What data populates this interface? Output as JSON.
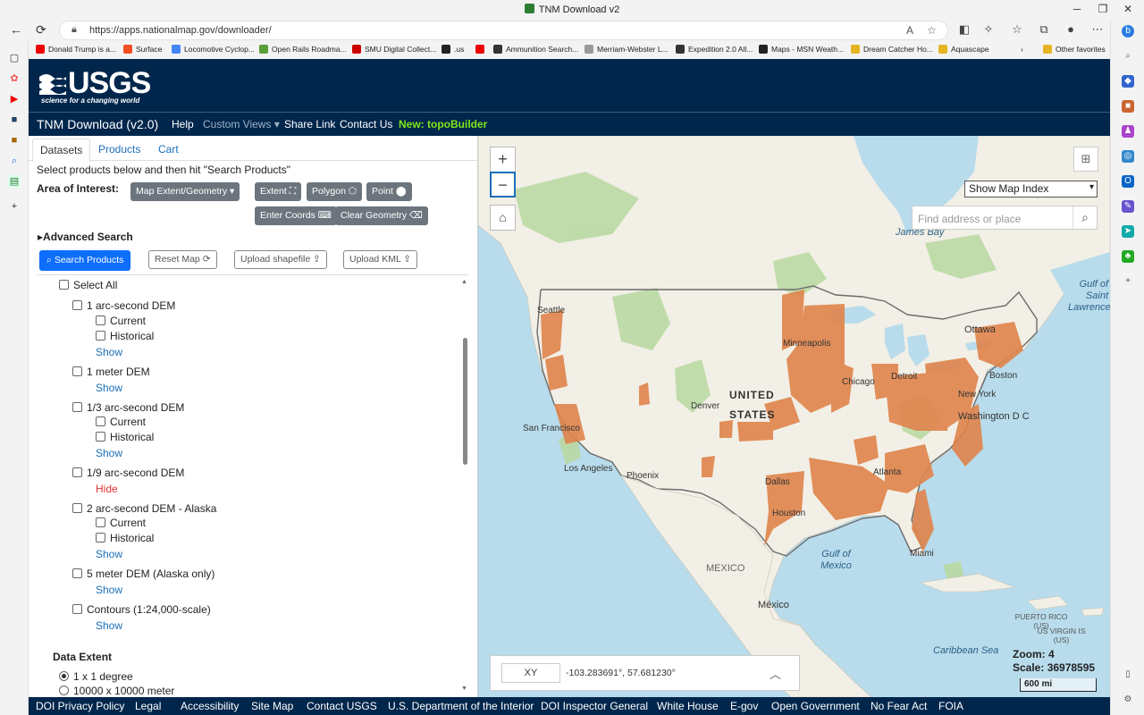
{
  "browser": {
    "window_title": "TNM Download v2",
    "url": "https://apps.nationalmap.gov/downloader/",
    "favorites": [
      {
        "label": "Donald Trump is a...",
        "color": "#e00"
      },
      {
        "label": "Surface",
        "color": "#f25022"
      },
      {
        "label": "Locomotive Cyclop...",
        "color": "#4285f4"
      },
      {
        "label": "Open Rails Roadma...",
        "color": "#5a9e3a"
      },
      {
        "label": "SMU Digital Collect...",
        "color": "#c00"
      },
      {
        "label": ".us",
        "color": "#222"
      },
      {
        "label": "",
        "color": "#e00"
      },
      {
        "label": "Ammunition Search...",
        "color": "#333"
      },
      {
        "label": "Merriam-Webster L...",
        "color": "#999"
      },
      {
        "label": "Expedition 2.0 All...",
        "color": "#333"
      },
      {
        "label": "Maps - MSN Weath...",
        "color": "#222"
      },
      {
        "label": "Dream Catcher Ho...",
        "color": "#e6b422"
      },
      {
        "label": "Aquascape",
        "color": "#e6b422"
      },
      {
        "label": "Other favorites",
        "color": "#e6b422"
      }
    ]
  },
  "header": {
    "logo_text": "USGS",
    "logo_tagline": "science for a changing world"
  },
  "nav": {
    "brand": "TNM Download (v2.0)",
    "help": "Help",
    "custom_views": "Custom Views",
    "share_link": "Share Link",
    "contact_us": "Contact Us",
    "topo_builder": "New: topoBuilder"
  },
  "panel": {
    "tabs": [
      "Datasets",
      "Products",
      "Cart"
    ],
    "active_tab": "Datasets",
    "instructions": "Select products below and then hit \"Search Products\"",
    "aoi_label": "Area of Interest:",
    "aoi_buttons": {
      "map_extent": "Map Extent/Geometry",
      "extent": "Extent",
      "polygon": "Polygon",
      "point": "Point",
      "enter_coords": "Enter Coords",
      "clear_geometry": "Clear Geometry"
    },
    "advanced_search": "Advanced Search",
    "actions": {
      "search_products": "Search Products",
      "reset_map": "Reset Map",
      "upload_shapefile": "Upload shapefile",
      "upload_kml": "Upload KML"
    },
    "select_all": "Select All",
    "current": "Current",
    "historical": "Historical",
    "show": "Show",
    "hide": "Hide",
    "products": [
      "1 arc-second DEM",
      "1 meter DEM",
      "1/3 arc-second DEM",
      "1/9 arc-second DEM",
      "2 arc-second DEM - Alaska",
      "5 meter DEM (Alaska only)",
      "Contours (1:24,000-scale)"
    ],
    "data_extent": {
      "label": "Data Extent",
      "options": [
        "1 x 1 degree",
        "10000 x 10000 meter"
      ],
      "selected": "1 x 1 degree"
    }
  },
  "map": {
    "index_select": "Show Map Index",
    "search_placeholder": "Find address or place",
    "coord_mode": "XY",
    "coord_value": "-103.283691°, 57.681230°",
    "zoom": "Zoom: 4",
    "scale": "Scale: 36978595",
    "scalebar": "600 mi",
    "labels": {
      "james_bay": "James Bay",
      "gulf_st_lawrence": "Gulf of Saint Lawrence",
      "seattle": "Seattle",
      "minneapolis": "Minneapolis",
      "ottawa": "Ottawa",
      "boston": "Boston",
      "detroit": "Detroit",
      "chicago": "Chicago",
      "new_york": "New York",
      "washington": "Washington D C",
      "united_states": "UNITED STATES",
      "denver": "Denver",
      "san_francisco": "San Francisco",
      "los_angeles": "Los Angeles",
      "phoenix": "Phoenix",
      "dallas": "Dallas",
      "atlanta": "Atlanta",
      "houston": "Houston",
      "miami": "Miami",
      "gulf_mexico": "Gulf of Mexico",
      "mexico": "MEXICO",
      "mexico_city": "México",
      "puerto_rico": "PUERTO RICO (US)",
      "us_virgin": "US VIRGIN IS (US)",
      "caribbean": "Caribbean Sea"
    },
    "colors": {
      "land": "#f2efe6",
      "water": "#b8dcec",
      "coverage": "#e0844b",
      "forest": "#b8d8a0"
    }
  },
  "footer": [
    "DOI Privacy Policy",
    "Legal",
    "Accessibility",
    "Site Map",
    "Contact USGS",
    "U.S. Department of the Interior",
    "DOI Inspector General",
    "White House",
    "E-gov",
    "Open Government",
    "No Fear Act",
    "FOIA"
  ]
}
